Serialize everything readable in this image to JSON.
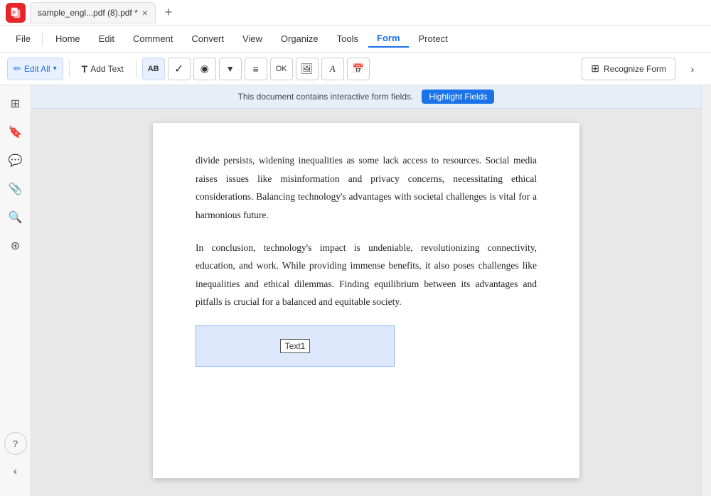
{
  "titleBar": {
    "tab": {
      "label": "sample_engl...pdf (8).pdf *",
      "closeLabel": "×"
    },
    "addTab": "+"
  },
  "menuBar": {
    "file": "File",
    "items": [
      {
        "id": "home",
        "label": "Home",
        "active": false
      },
      {
        "id": "edit",
        "label": "Edit",
        "active": false
      },
      {
        "id": "comment",
        "label": "Comment",
        "active": false
      },
      {
        "id": "convert",
        "label": "Convert",
        "active": false
      },
      {
        "id": "view",
        "label": "View",
        "active": false
      },
      {
        "id": "organize",
        "label": "Organize",
        "active": false
      },
      {
        "id": "tools",
        "label": "Tools",
        "active": false
      },
      {
        "id": "form",
        "label": "Form",
        "active": true
      },
      {
        "id": "protect",
        "label": "Protect",
        "active": false
      }
    ]
  },
  "toolbar": {
    "editAll": "Edit All",
    "addText": "Add Text",
    "icons": [
      {
        "id": "ab-icon",
        "symbol": "AB",
        "type": "text"
      },
      {
        "id": "check-icon",
        "symbol": "✓",
        "type": "check"
      },
      {
        "id": "radio-icon",
        "symbol": "◉",
        "type": "radio"
      },
      {
        "id": "dropdown-icon",
        "symbol": "▼",
        "type": "dropdown"
      },
      {
        "id": "list-icon",
        "symbol": "≡",
        "type": "list"
      },
      {
        "id": "button-icon",
        "symbol": "OK",
        "type": "button"
      },
      {
        "id": "image-icon",
        "symbol": "🖼",
        "type": "image"
      },
      {
        "id": "sig-icon",
        "symbol": "A",
        "type": "signature"
      },
      {
        "id": "date-icon",
        "symbol": "📅",
        "type": "date"
      }
    ],
    "recognizeForm": "Recognize Form",
    "moreBtn": "›"
  },
  "sidebar": {
    "icons": [
      {
        "id": "pages",
        "symbol": "⊞"
      },
      {
        "id": "bookmarks",
        "symbol": "🔖"
      },
      {
        "id": "comments",
        "symbol": "💬"
      },
      {
        "id": "attachments",
        "symbol": "📎"
      },
      {
        "id": "search",
        "symbol": "🔍"
      },
      {
        "id": "layers",
        "symbol": "⊛"
      }
    ],
    "bottom": [
      {
        "id": "help",
        "symbol": "?"
      },
      {
        "id": "collapse",
        "symbol": "‹"
      }
    ]
  },
  "notification": {
    "text": "This document contains interactive form fields.",
    "buttonLabel": "Highlight Fields"
  },
  "document": {
    "paragraphs": [
      "divide persists, widening inequalities as some lack access to resources. Social media raises issues like misinformation and privacy concerns, necessitating ethical considerations. Balancing technology's advantages with societal challenges is vital for a harmonious future.",
      "In conclusion, technology's impact is undeniable, revolutionizing connectivity, education, and work. While providing immense benefits, it also poses challenges like inequalities and ethical dilemmas. Finding equilibrium between its advantages and pitfalls is crucial for a balanced and equitable society."
    ],
    "textField": {
      "label": "Text1"
    }
  }
}
